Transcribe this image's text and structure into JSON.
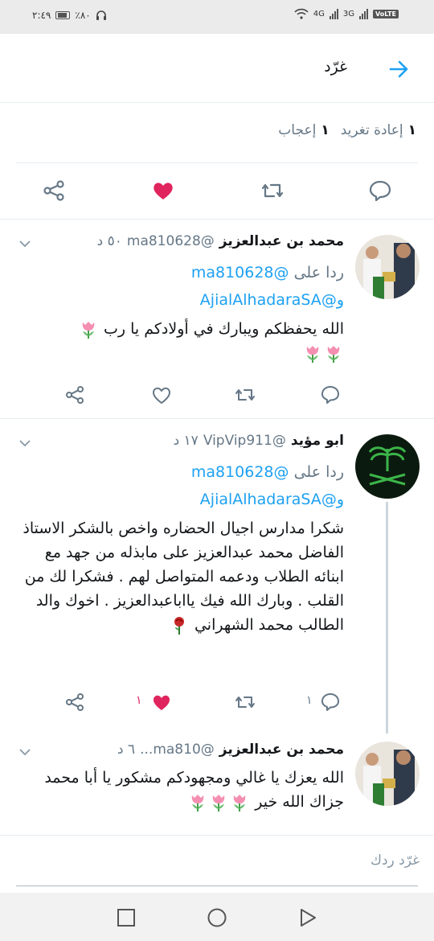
{
  "status_bar": {
    "time": "٢:٤٩",
    "battery": "٪٨٠",
    "signal_1": "4G",
    "signal_2": "3G",
    "volte": "VoLTE"
  },
  "header": {
    "title": "غرّد"
  },
  "stats": {
    "retweets_count": "١",
    "retweets_label": "إعادة تغريد",
    "likes_count": "١",
    "likes_label": "إعجاب"
  },
  "tweets": [
    {
      "name": "محمد بن عبدالعزيز",
      "handle": "@ma810628",
      "time": "٥٠ د",
      "reply_prefix": "ردا على",
      "reply_mention": "@ma810628",
      "reply_mention2": "و@AjialAlhadaraSA",
      "body": "الله يحفظكم ويبارك في أولادكم يا رب",
      "reply_count": "",
      "like_count": ""
    },
    {
      "name": "ابو مؤيد",
      "handle": "@VipVip911",
      "time": "١٧ د",
      "reply_prefix": "ردا على",
      "reply_mention": "@ma810628",
      "reply_mention2": "و@AjialAlhadaraSA",
      "body": "شكرا مدارس اجيال الحضاره واخص بالشكر الاستاذ الفاضل محمد عبدالعزيز على مابذله من جهد مع ابنائه الطلاب ودعمه المتواصل لهم . فشكرا لك من القلب . وبارك الله فيك ياابا‌عبدالعزيز . اخوك والد الطالب محمد الشهراني",
      "reply_count": "١",
      "like_count": "١"
    },
    {
      "name": "محمد بن عبدالعزيز",
      "handle": "@ma810...",
      "time": "٦ د",
      "body": "الله يعزك يا غالي ومجهودكم مشكور يا أبا محمد جزاك الله خير"
    }
  ],
  "reply_box": {
    "placeholder": "غرّد ردك"
  },
  "colors": {
    "accent": "#1da1f2",
    "like": "#e0245e",
    "secondary_text": "#657786"
  }
}
